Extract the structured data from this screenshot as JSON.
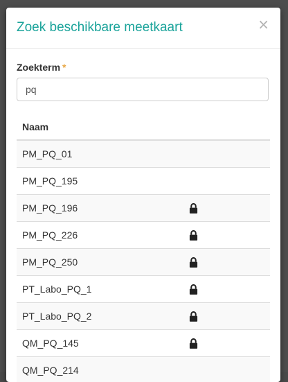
{
  "modal": {
    "title": "Zoek beschikbare meetkaart",
    "close_label": "×"
  },
  "search": {
    "label": "Zoekterm",
    "required_marker": "*",
    "value": "pq"
  },
  "table": {
    "header_name": "Naam",
    "rows": [
      {
        "name": "PM_PQ_01",
        "locked": false
      },
      {
        "name": "PM_PQ_195",
        "locked": false
      },
      {
        "name": "PM_PQ_196",
        "locked": true
      },
      {
        "name": "PM_PQ_226",
        "locked": true
      },
      {
        "name": "PM_PQ_250",
        "locked": true
      },
      {
        "name": "PT_Labo_PQ_1",
        "locked": true
      },
      {
        "name": "PT_Labo_PQ_2",
        "locked": true
      },
      {
        "name": "QM_PQ_145",
        "locked": true
      },
      {
        "name": "QM_PQ_214",
        "locked": false
      }
    ]
  },
  "colors": {
    "title": "#1aa39a",
    "required": "#e8a94a"
  },
  "icons": {
    "close": "close-icon",
    "lock": "lock-icon"
  }
}
